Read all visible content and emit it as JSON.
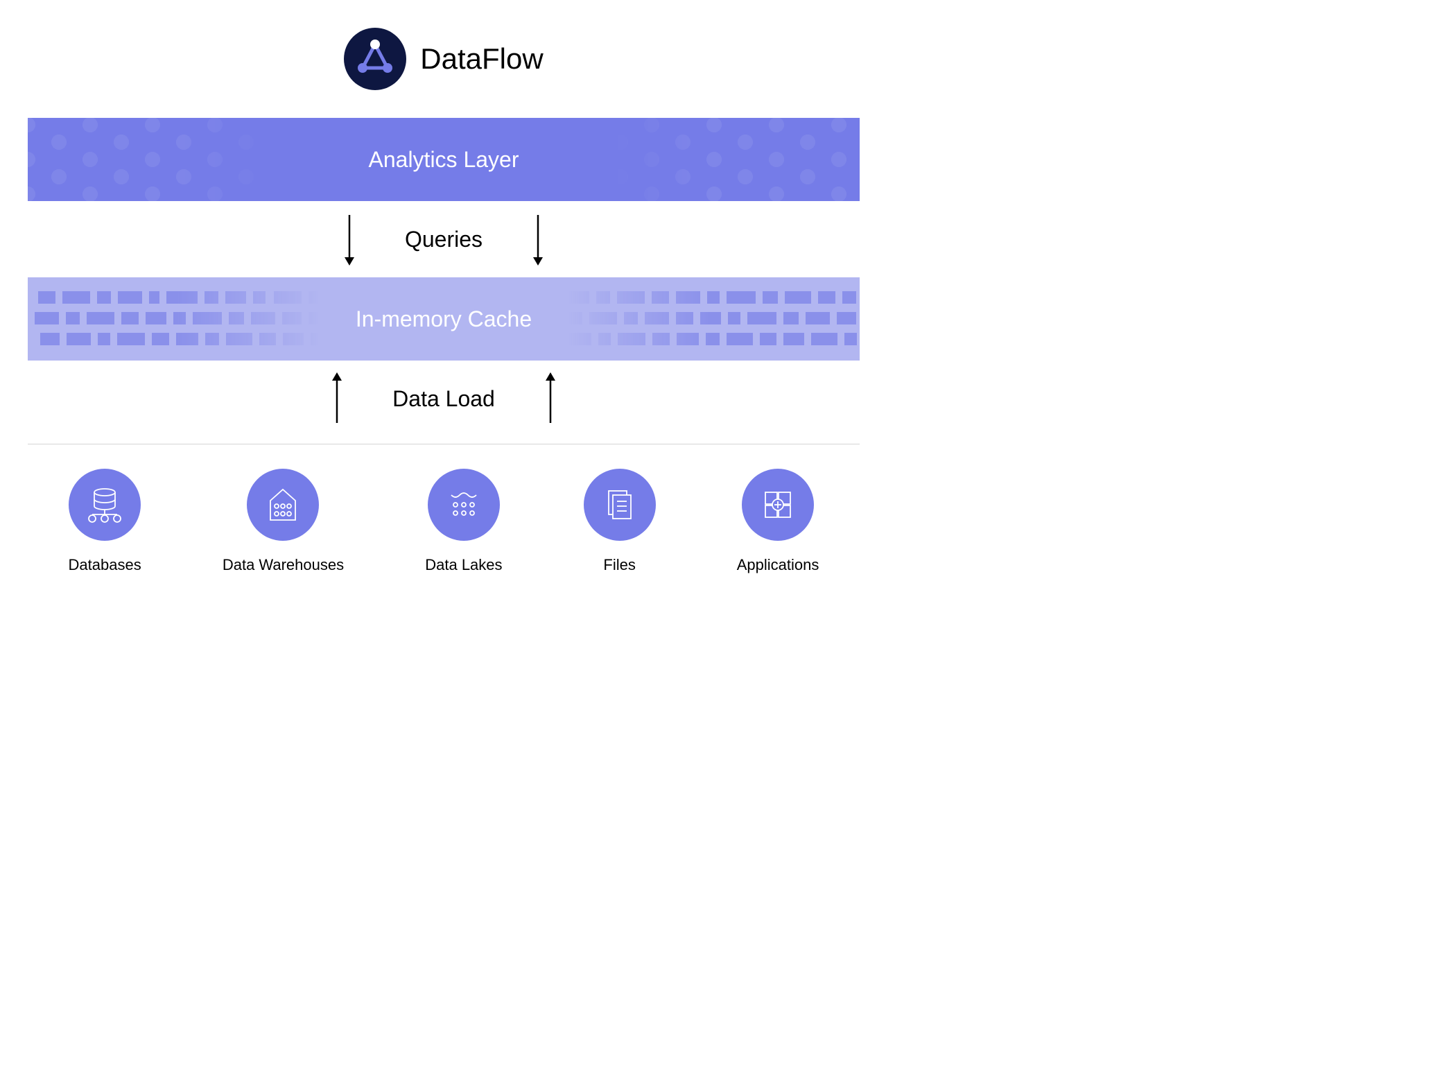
{
  "header": {
    "title": "DataFlow"
  },
  "layers": {
    "analytics": "Analytics Layer",
    "cache": "In-memory Cache"
  },
  "flows": {
    "queries": "Queries",
    "dataload": "Data Load"
  },
  "sources": [
    {
      "id": "databases",
      "label": "Databases"
    },
    {
      "id": "warehouses",
      "label": "Data Warehouses"
    },
    {
      "id": "lakes",
      "label": "Data Lakes"
    },
    {
      "id": "files",
      "label": "Files"
    },
    {
      "id": "applications",
      "label": "Applications"
    }
  ]
}
